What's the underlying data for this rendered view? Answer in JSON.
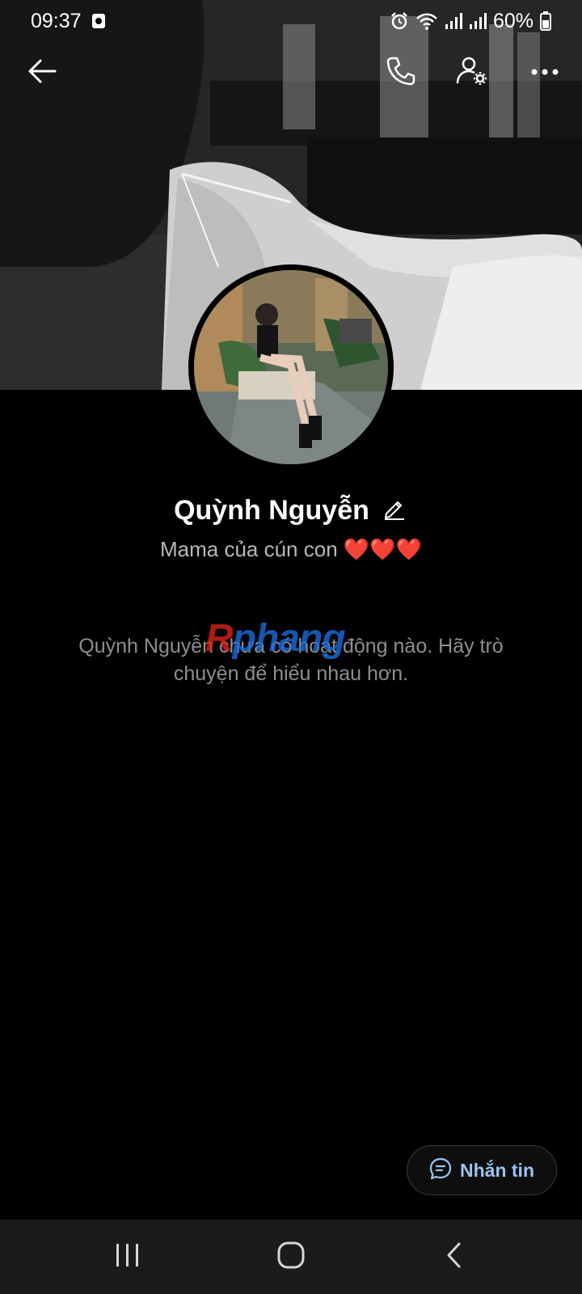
{
  "status_bar": {
    "time": "09:37",
    "battery": "60%",
    "icons": [
      "screen-record-icon",
      "alarm-icon",
      "wifi-icon",
      "signal-icon",
      "signal-icon",
      "battery-icon"
    ]
  },
  "top_bar": {
    "icons": [
      "back-arrow-icon",
      "phone-call-icon",
      "user-settings-icon",
      "more-dots-icon"
    ]
  },
  "profile": {
    "name": "Quỳnh Nguyễn",
    "bio": "Mama của cún con ❤️❤️❤️"
  },
  "activity": {
    "empty_message": "Quỳnh Nguyễn chưa có hoạt động nào. Hãy trò chuyện để hiểu nhau hơn."
  },
  "watermark": {
    "part1": "R",
    "part2": "phang"
  },
  "message_button": {
    "label": "Nhắn tin",
    "icon": "chat-bubble-icon"
  },
  "nav_bar": {
    "icons": [
      "recent-apps-icon",
      "home-icon",
      "back-icon"
    ]
  },
  "colors": {
    "background": "#000000",
    "accent_text": "#9cc4f0",
    "secondary_text": "#b8b8b8",
    "nav_bar": "#1b1b1b"
  }
}
